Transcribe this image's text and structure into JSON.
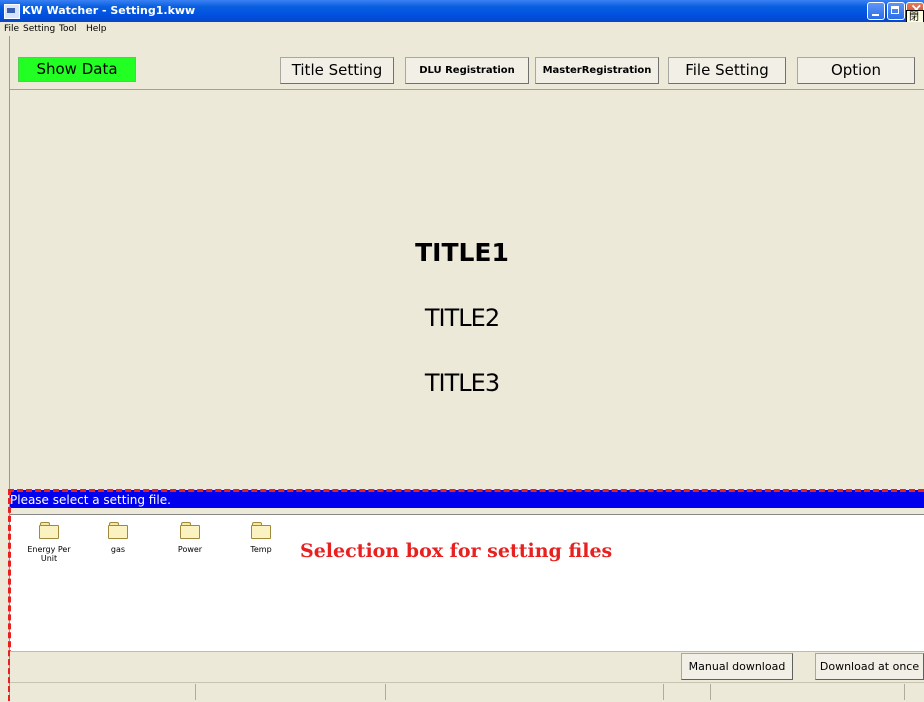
{
  "window": {
    "title": "KW Watcher - Setting1.kww",
    "close_tooltip": "閉じ"
  },
  "menu": [
    "File",
    "Setting",
    "Tool",
    "Help"
  ],
  "toolbar": {
    "show_data": "Show Data",
    "title_setting": "Title Setting",
    "dlu_registration": "DLU Registration",
    "master_registration": "MasterRegistration",
    "file_setting": "File Setting",
    "option": "Option"
  },
  "main": {
    "title1": "TITLE1",
    "title2": "TITLE2",
    "title3": "TITLE3"
  },
  "selection": {
    "header": "Please select a setting file.",
    "folders": [
      "Energy Per Unit",
      "gas",
      "Power",
      "Temp"
    ],
    "annotation": "Selection box for setting files"
  },
  "buttons": {
    "manual_download": "Manual download",
    "download_at_once": "Download at once"
  },
  "colors": {
    "show_data_bg": "#22ff22",
    "header_bg": "#0000ee",
    "annotation": "#e82020"
  }
}
